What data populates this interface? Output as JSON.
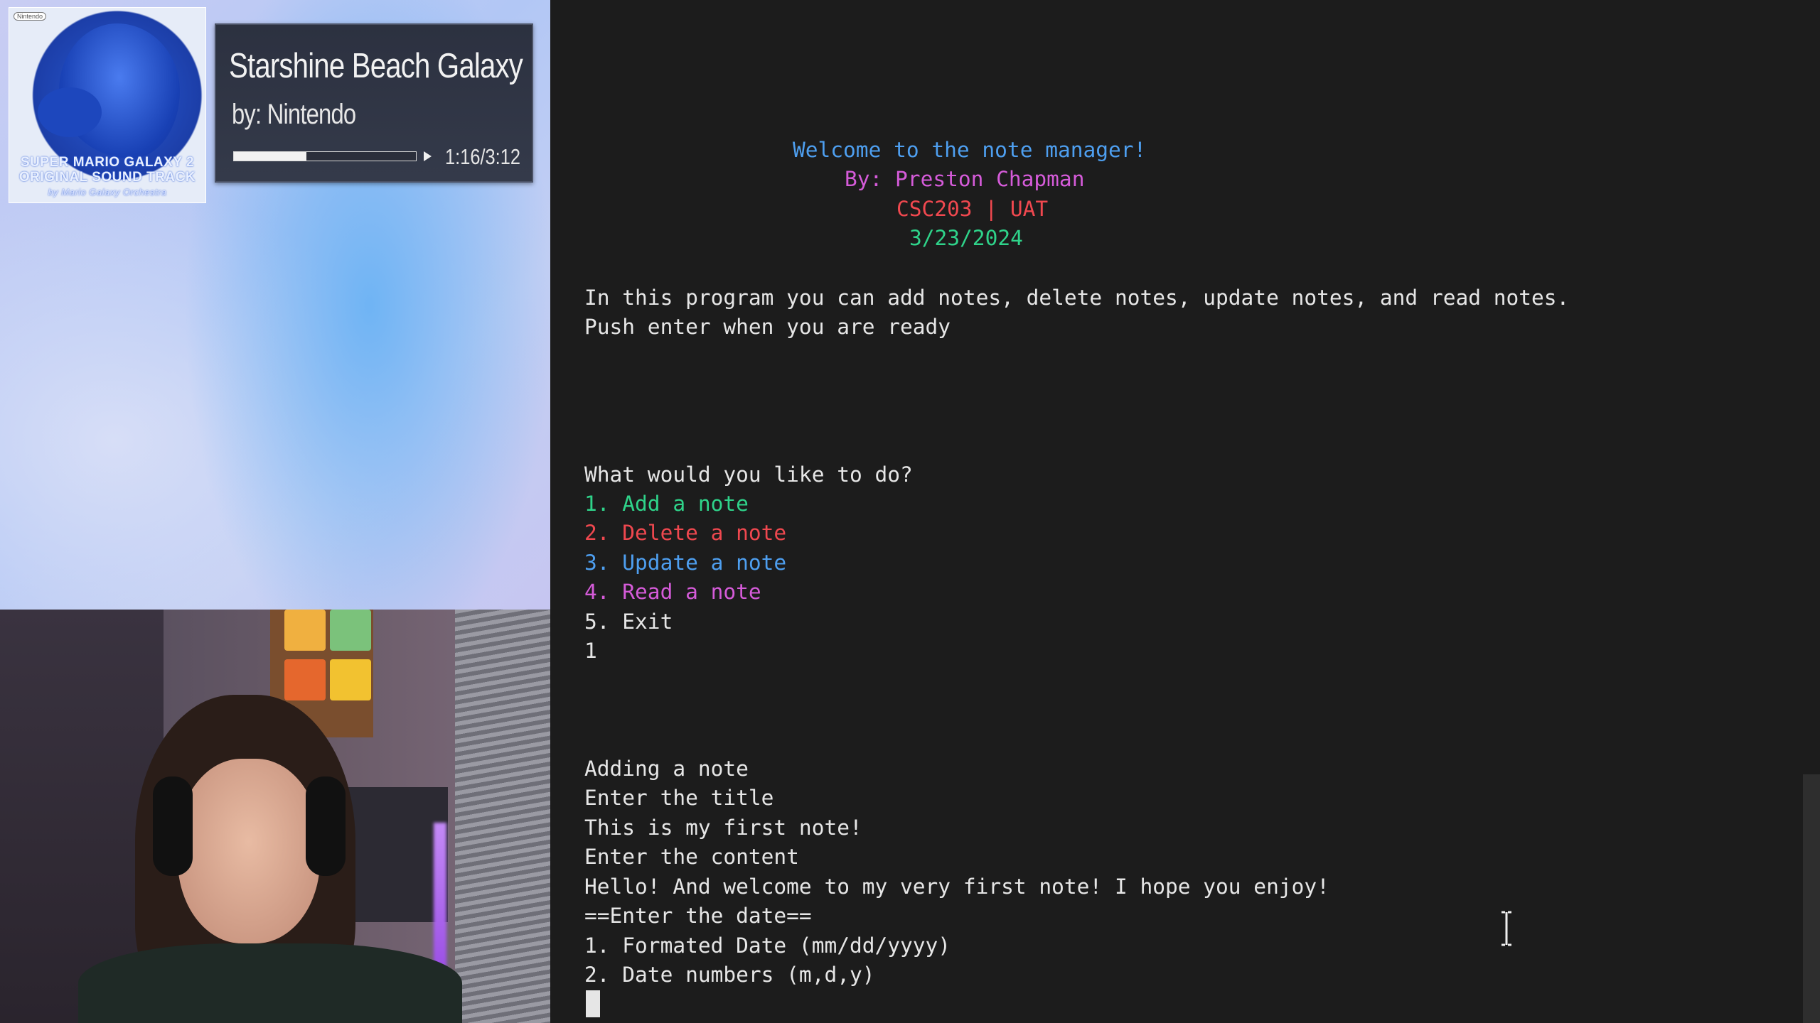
{
  "overlay": {
    "album": {
      "caption_line1": "SUPER MARIO GALAXY 2",
      "caption_line2": "ORIGINAL SOUND TRACK",
      "caption_line3": "by Mario Galaxy Orchestra",
      "publisher_logo": "Nintendo"
    },
    "now_playing": {
      "title": "Starshine Beach Galaxy",
      "artist": "by: Nintendo",
      "time": "1:16/3:12",
      "progress_fraction": 0.4
    }
  },
  "terminal": {
    "header": [
      {
        "text": "Welcome to the note manager!",
        "color": "#4e9ff0"
      },
      {
        "text": "By: Preston Chapman",
        "color": "#d55bd9"
      },
      {
        "text": "CSC203 | UAT",
        "color": "#f0484f"
      },
      {
        "text": "3/23/2024",
        "color": "#2fd38a"
      }
    ],
    "intro_line1": "In this program you can add notes, delete notes, update notes, and read notes.",
    "intro_line2": "Push enter when you are ready",
    "menu_prompt": "What would you like to do?",
    "menu": [
      {
        "text": "1. Add a note",
        "color": "#2fd38a"
      },
      {
        "text": "2. Delete a note",
        "color": "#f0484f"
      },
      {
        "text": "3. Update a note",
        "color": "#4e9ff0"
      },
      {
        "text": "4. Read a note",
        "color": "#d55bd9"
      },
      {
        "text": "5. Exit",
        "color": "#e6e6e6"
      }
    ],
    "user_choice": "1",
    "session": [
      "Adding a note",
      "Enter the title",
      "This is my first note!",
      "Enter the content",
      "Hello! And welcome to my very first note! I hope you enjoy!",
      "==Enter the date==",
      "1. Formated Date (mm/dd/yyyy)",
      "2. Date numbers (m,d,y)"
    ]
  }
}
